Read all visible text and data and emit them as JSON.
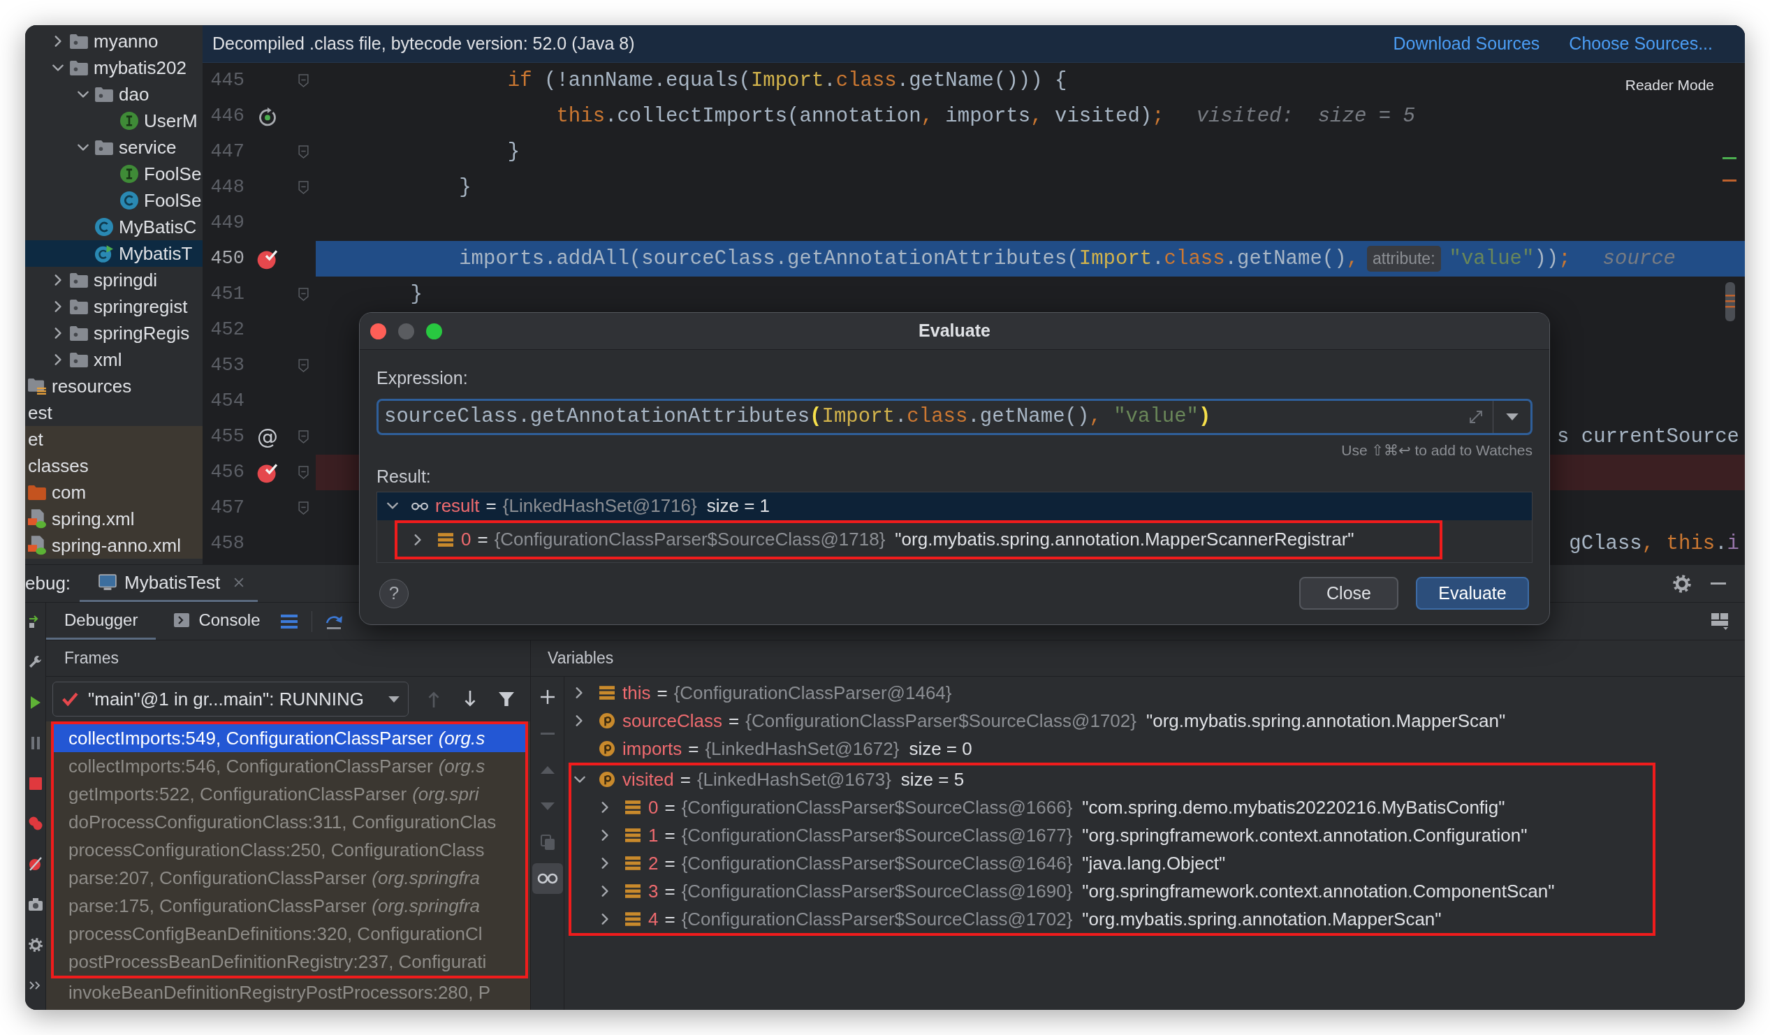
{
  "project_tree": [
    {
      "children": [
        {
          "children": [
            {
              "children": [
                {
                  "label": "myanno",
                  "kind": "folder",
                  "expanded": false,
                  "selected": false
                },
                {
                  "label": "mybatis202",
                  "kind": "folder",
                  "expanded": true,
                  "selected": false,
                  "children": [
                    {
                      "label": "dao",
                      "kind": "folder",
                      "expanded": true,
                      "selected": false,
                      "children": [
                        {
                          "label": "UserM",
                          "kind": "interface",
                          "selected": false
                        }
                      ]
                    },
                    {
                      "label": "service",
                      "kind": "folder",
                      "expanded": true,
                      "selected": false,
                      "children": [
                        {
                          "label": "FoolSe",
                          "kind": "interface",
                          "selected": false
                        },
                        {
                          "label": "FoolSe",
                          "kind": "class",
                          "selected": false
                        }
                      ]
                    },
                    {
                      "label": "MyBatisC",
                      "kind": "class",
                      "selected": false
                    },
                    {
                      "label": "MybatisT",
                      "kind": "test-class",
                      "selected": true
                    }
                  ]
                },
                {
                  "label": "springdi",
                  "kind": "folder",
                  "expanded": false,
                  "selected": false
                },
                {
                  "label": "springregist",
                  "kind": "folder",
                  "expanded": false,
                  "selected": false
                },
                {
                  "label": "springRegis",
                  "kind": "folder",
                  "expanded": false,
                  "selected": false
                },
                {
                  "label": "xml",
                  "kind": "folder",
                  "expanded": false,
                  "selected": false
                }
              ]
            }
          ]
        },
        {
          "label": "resources",
          "kind": "resources-folder",
          "selected": false
        }
      ]
    },
    {
      "label": "est",
      "selected": false
    },
    {
      "label": "et",
      "selected": false,
      "excluded": true
    },
    {
      "label": "classes",
      "selected": false,
      "excluded": true,
      "children": [
        {
          "label": "com",
          "kind": "output-folder",
          "selected": false,
          "excluded": true
        },
        {
          "label": "spring.xml",
          "kind": "spring-xml",
          "selected": false,
          "excluded": true
        },
        {
          "label": "spring-anno.xml",
          "kind": "spring-xml",
          "selected": false,
          "excluded": true
        }
      ]
    }
  ],
  "editor": {
    "banner": {
      "text": "Decompiled .class file, bytecode version: 52.0 (Java 8)",
      "links": [
        "Download Sources",
        "Choose Sources..."
      ]
    },
    "reader_mode": "Reader Mode",
    "lines": [
      {
        "number": "445",
        "fold": true,
        "tokens": [
          {
            "kind": "keyword",
            "text": "            if"
          },
          {
            "kind": "plain",
            "text": " (!annName.equals("
          },
          {
            "kind": "type",
            "text": "Import"
          },
          {
            "kind": "plain",
            "text": "."
          },
          {
            "kind": "keyword",
            "text": "class"
          },
          {
            "kind": "plain",
            "text": ".getName())) {"
          }
        ]
      },
      {
        "number": "446",
        "restart_marker": true,
        "tokens": [
          {
            "kind": "keyword",
            "text": "                this"
          },
          {
            "kind": "plain",
            "text": ".collectImports(annotation"
          },
          {
            "kind": "punct",
            "text": ","
          },
          {
            "kind": "plain",
            "text": " imports"
          },
          {
            "kind": "punct",
            "text": ","
          },
          {
            "kind": "plain",
            "text": " visited)"
          },
          {
            "kind": "punct",
            "text": ";"
          },
          {
            "kind": "hint",
            "text": "visited:  size = 5"
          }
        ]
      },
      {
        "number": "447",
        "fold": true,
        "tokens": [
          {
            "kind": "plain",
            "text": "            }"
          }
        ]
      },
      {
        "number": "448",
        "fold": true,
        "tokens": [
          {
            "kind": "plain",
            "text": "        }"
          }
        ]
      },
      {
        "number": "449"
      },
      {
        "number": "450",
        "breakpoint": true,
        "current": true,
        "tokens": [
          {
            "kind": "plain",
            "text": "        imports.addAll(sourceClass.getAnnotationAttributes("
          },
          {
            "kind": "type",
            "text": "Import"
          },
          {
            "kind": "plain",
            "text": "."
          },
          {
            "kind": "keyword",
            "text": "class"
          },
          {
            "kind": "plain",
            "text": ".getName()"
          },
          {
            "kind": "punct",
            "text": ","
          },
          {
            "kind": "inlay",
            "text": "attribute:"
          },
          {
            "kind": "string",
            "text": "\"value\""
          },
          {
            "kind": "plain",
            "text": "))"
          },
          {
            "kind": "punct",
            "text": ";"
          },
          {
            "kind": "hint",
            "text": "source"
          }
        ]
      },
      {
        "number": "451",
        "fold": true,
        "tokens": [
          {
            "kind": "plain",
            "text": "    }"
          }
        ]
      },
      {
        "number": "452"
      },
      {
        "number": "453",
        "fold": true
      },
      {
        "number": "454"
      },
      {
        "number": "455",
        "fold": true,
        "gutter_text": "@",
        "tail": [
          {
            "kind": "plain",
            "text": "s currentSource"
          }
        ]
      },
      {
        "number": "456",
        "fold": true,
        "breakpoint": true
      },
      {
        "number": "457",
        "fold": true
      },
      {
        "number": "458",
        "tail": [
          {
            "kind": "plain",
            "text": "gClass"
          },
          {
            "kind": "punct",
            "text": ","
          },
          {
            "kind": "keyword",
            "text": " this"
          },
          {
            "kind": "plain",
            "text": "."
          },
          {
            "kind": "field",
            "text": "i"
          }
        ]
      }
    ]
  },
  "debug": {
    "title": "ebug:",
    "tabs": [
      {
        "label": "MybatisTest",
        "selected": true
      }
    ],
    "subtabs": [
      {
        "label": "Debugger",
        "kind": "plain",
        "selected": true
      },
      {
        "label": "Console",
        "kind": "console",
        "selected": false
      }
    ],
    "frames": {
      "title": "Frames",
      "thread": "\"main\"@1 in gr...main\": RUNNING",
      "groups": [
        {
          "outlined": true,
          "items": [
            {
              "method": "collectImports:549, ConfigurationClassParser",
              "package": "(org.s",
              "selected": true
            },
            {
              "method": "collectImports:546, ConfigurationClassParser",
              "package": "(org.s",
              "selected": false
            },
            {
              "method": "getImports:522, ConfigurationClassParser",
              "package": "(org.spri",
              "selected": false
            },
            {
              "method": "doProcessConfigurationClass:311, ConfigurationClas",
              "selected": false
            },
            {
              "method": "processConfigurationClass:250, ConfigurationClass",
              "selected": false
            },
            {
              "method": "parse:207, ConfigurationClassParser",
              "package": "(org.springfra",
              "selected": false
            },
            {
              "method": "parse:175, ConfigurationClassParser",
              "package": "(org.springfra",
              "selected": false
            },
            {
              "method": "processConfigBeanDefinitions:320, ConfigurationCl",
              "selected": false
            },
            {
              "method": "postProcessBeanDefinitionRegistry:237, Configurati",
              "selected": false
            }
          ]
        },
        {
          "items": [
            {
              "method": "invokeBeanDefinitionRegistryPostProcessors:280, P",
              "selected": false
            }
          ]
        }
      ]
    },
    "variables": {
      "title": "Variables",
      "items": [
        {
          "name": "this",
          "kind": "field",
          "expanded": false,
          "selected": false,
          "equals": "=",
          "ref": "{ConfigurationClassParser@1464}"
        },
        {
          "name": "sourceClass",
          "kind": "param",
          "expanded": false,
          "selected": false,
          "equals": "=",
          "ref": "{ConfigurationClassParser$SourceClass@1702}",
          "value": "\"org.mybatis.spring.annotation.MapperScan\""
        },
        {
          "name": "imports",
          "kind": "param",
          "selected": false,
          "equals": "=",
          "ref": "{LinkedHashSet@1672}",
          "value": "size = 0"
        },
        {
          "name": "visited",
          "kind": "param",
          "expanded": true,
          "selected": false,
          "outlined": true,
          "equals": "=",
          "ref": "{LinkedHashSet@1673}",
          "value": "size = 5",
          "children": [
            {
              "name": "0",
              "kind": "field",
              "expanded": false,
              "selected": false,
              "equals": "=",
              "ref": "{ConfigurationClassParser$SourceClass@1666}",
              "value": "\"com.spring.demo.mybatis20220216.MyBatisConfig\""
            },
            {
              "name": "1",
              "kind": "field",
              "expanded": false,
              "selected": false,
              "equals": "=",
              "ref": "{ConfigurationClassParser$SourceClass@1677}",
              "value": "\"org.springframework.context.annotation.Configuration\""
            },
            {
              "name": "2",
              "kind": "field",
              "expanded": false,
              "selected": false,
              "equals": "=",
              "ref": "{ConfigurationClassParser$SourceClass@1646}",
              "value": "\"java.lang.Object\""
            },
            {
              "name": "3",
              "kind": "field",
              "expanded": false,
              "selected": false,
              "equals": "=",
              "ref": "{ConfigurationClassParser$SourceClass@1690}",
              "value": "\"org.springframework.context.annotation.ComponentScan\""
            },
            {
              "name": "4",
              "kind": "field",
              "expanded": false,
              "selected": false,
              "equals": "=",
              "ref": "{ConfigurationClassParser$SourceClass@1702}",
              "value": "\"org.mybatis.spring.annotation.MapperScan\""
            }
          ]
        }
      ]
    }
  },
  "evaluate_dialog": {
    "title": "Evaluate",
    "expression_label": "Expression:",
    "expression": [
      {
        "kind": "plain",
        "text": "sourceClass.getAnnotationAttributes"
      },
      {
        "kind": "bracket",
        "text": "("
      },
      {
        "kind": "type",
        "text": "Import"
      },
      {
        "kind": "plain",
        "text": "."
      },
      {
        "kind": "keyword",
        "text": "class"
      },
      {
        "kind": "plain",
        "text": ".getName()"
      },
      {
        "kind": "punct",
        "text": ","
      },
      {
        "kind": "string",
        "text": " \"value\""
      },
      {
        "kind": "bracket",
        "text": ")"
      }
    ],
    "watch_hint": "Use ⇧⌘↩ to add to Watches",
    "result_label": "Result:",
    "result": [
      {
        "name": "result",
        "kind": "watch",
        "expanded": true,
        "selected": true,
        "equals": "=",
        "ref": "{LinkedHashSet@1716}",
        "value": "size = 1",
        "children": [
          {
            "name": "0",
            "kind": "field",
            "expanded": false,
            "selected": false,
            "outlined": true,
            "equals": "=",
            "ref": "{ConfigurationClassParser$SourceClass@1718}",
            "value": "\"org.mybatis.spring.annotation.MapperScannerRegistrar\""
          }
        ]
      }
    ],
    "help": "?",
    "buttons": [
      {
        "label": "Close",
        "kind": "secondary"
      },
      {
        "label": "Evaluate",
        "kind": "primary"
      }
    ]
  }
}
